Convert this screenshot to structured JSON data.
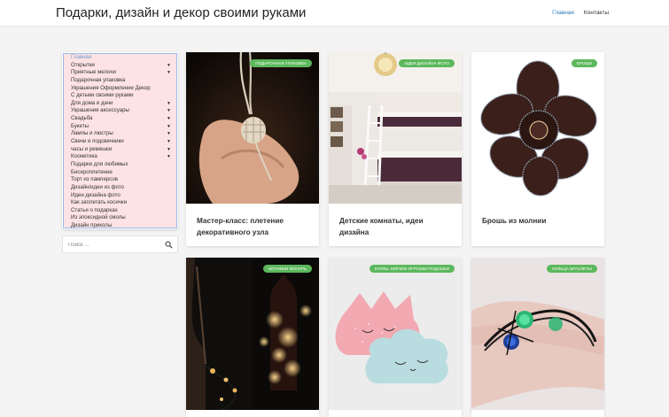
{
  "header": {
    "site_title": "Подарки, дизайн и декор своими руками",
    "nav": [
      {
        "label": "Главная"
      },
      {
        "label": "Контакты"
      }
    ]
  },
  "sidebar": {
    "items": [
      {
        "label": "Главная"
      },
      {
        "label": "Открытки"
      },
      {
        "label": "Приятные мелочи"
      },
      {
        "label": "Подарочная упаковка"
      },
      {
        "label": "Украшения Оформление Декор"
      },
      {
        "label": "С детьми своими руками"
      },
      {
        "label": "Для дома и дачи"
      },
      {
        "label": "Украшения аксессуары"
      },
      {
        "label": "Свадьба"
      },
      {
        "label": "Букеты"
      },
      {
        "label": "Лампы и люстры"
      },
      {
        "label": "Свечи и подсвечники"
      },
      {
        "label": "часы и ремешки"
      },
      {
        "label": "Косметика"
      },
      {
        "label": "Подарки для любимых"
      },
      {
        "label": "Бисероплетение"
      },
      {
        "label": "Торт из памперсов"
      },
      {
        "label": "Дизайн/идеи из фото"
      },
      {
        "label": "Идеи дизайна фото"
      },
      {
        "label": "Как заплетать косички"
      },
      {
        "label": "Статьи о подарках"
      },
      {
        "label": "Из эпоксидной смолы"
      },
      {
        "label": "Дизайн приколы"
      }
    ],
    "arrow": "▼"
  },
  "search": {
    "placeholder": "Поиск ..."
  },
  "cards": [
    {
      "tag": "ПОДАРОЧНАЯ УПАКОВКА",
      "title": "Мастер-класс: плетение декоративного узла"
    },
    {
      "tag": "ИДЕИ ДИЗАЙНА ФОТО",
      "title": "Детские комнаты, идеи дизайна"
    },
    {
      "tag": "БРОШИ",
      "title": "Брошь из молнии"
    },
    {
      "tag": "НОЧНИКИ ФОНАРЬ",
      "title": ""
    },
    {
      "tag": "КУКЛЫ, МЯГКИЕ ИГРУШКИ ПОДУШКИ",
      "title": ""
    },
    {
      "tag": "КОЛЬЦА БРАСЛЕТЫ",
      "title": ""
    }
  ],
  "colors": {
    "tag_bg": "#5cb85c",
    "nav_active": "#2a7ab8",
    "menu_bg": "#fde3e3",
    "menu_border": "#9bb8e4"
  }
}
